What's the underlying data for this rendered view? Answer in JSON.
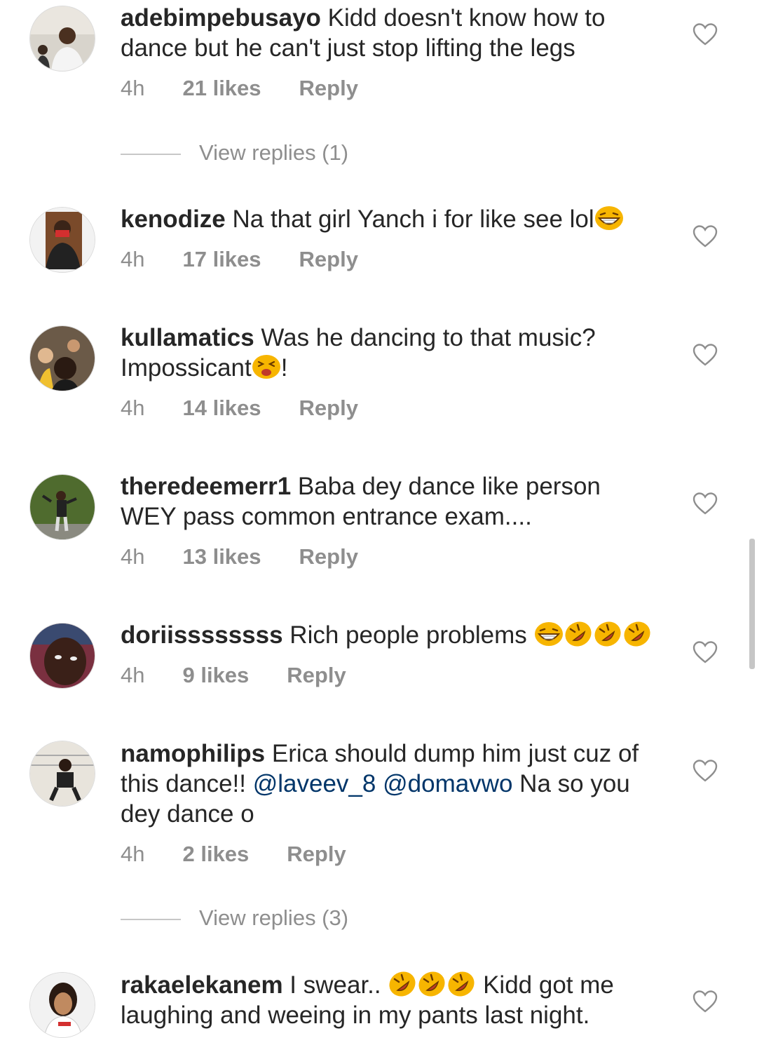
{
  "comments": [
    {
      "username": "adebimpebusayo",
      "text": " Kidd doesn't know how to dance but he can't just stop lifting the legs",
      "time": "4h",
      "likes": "21 likes",
      "reply": "Reply",
      "view_replies": "View replies (1)"
    },
    {
      "username": "kenodize",
      "text": " Na that girl Yanch i for like see lol",
      "time": "4h",
      "likes": "17 likes",
      "reply": "Reply"
    },
    {
      "username": "kullamatics",
      "text": " Was he dancing to that music? Impossicant",
      "text_after": "!",
      "time": "4h",
      "likes": "14 likes",
      "reply": "Reply"
    },
    {
      "username": "theredeemerr1",
      "text": " Baba dey dance like person WEY pass common entrance exam....",
      "time": "4h",
      "likes": "13 likes",
      "reply": "Reply"
    },
    {
      "username": "doriissssssss",
      "text": " Rich people problems ",
      "time": "4h",
      "likes": "9 likes",
      "reply": "Reply"
    },
    {
      "username": "namophilips",
      "text": " Erica should dump him just cuz of this dance!! ",
      "mention1": "@laveev_8",
      "mention2": "@domavwo",
      "text_after": " Na so you dey dance o",
      "time": "4h",
      "likes": "2 likes",
      "reply": "Reply",
      "view_replies": "View replies (3)"
    },
    {
      "username": "rakaelekanem",
      "text": " I swear.. ",
      "text_after": " Kidd got me laughing and weeing in my pants last night."
    }
  ],
  "icons": {
    "like": "heart-outline-icon",
    "emoji_grin": "grinning-squinting-face-emoji",
    "emoji_rofl": "rolling-on-floor-laughing-emoji",
    "emoji_persevere": "tired-face-emoji"
  },
  "colors": {
    "text": "#262626",
    "secondary": "#8e8e8e",
    "mention": "#003569",
    "emoji": "#f7b500"
  }
}
